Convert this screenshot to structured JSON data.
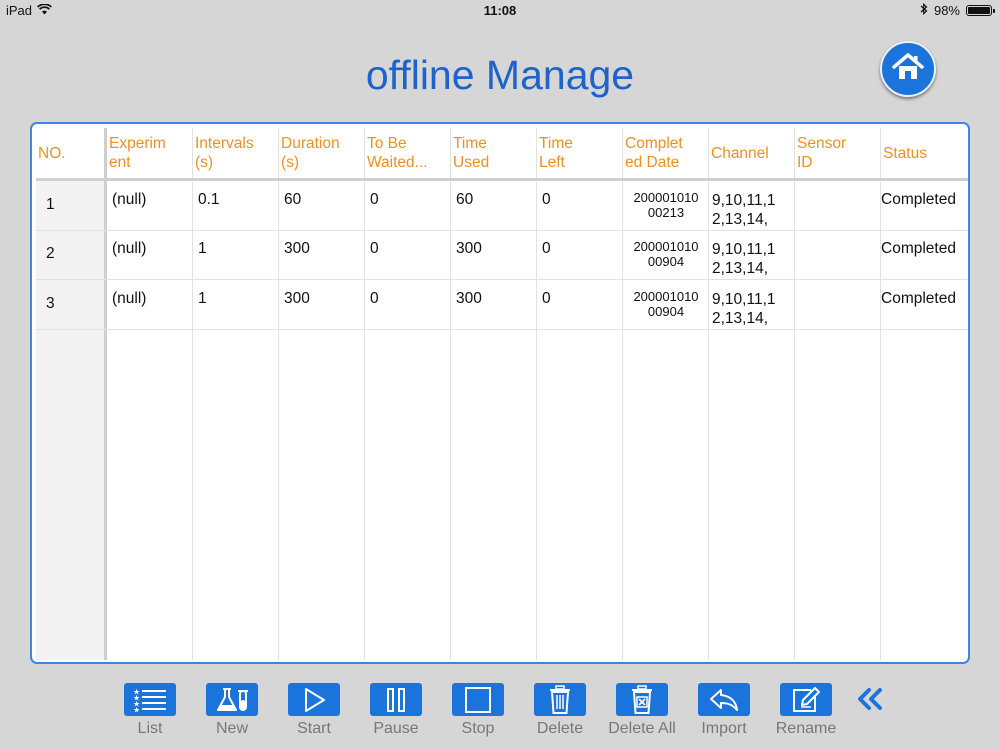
{
  "status_bar": {
    "device": "iPad",
    "time": "11:08",
    "battery": "98%",
    "battery_level": 0.98
  },
  "title": "offline Manage",
  "table": {
    "headers": [
      {
        "text": "NO.",
        "lines": [
          "NO."
        ]
      },
      {
        "text": "Experiment",
        "lines": [
          "Experim",
          "ent"
        ]
      },
      {
        "text": "Intervals (s)",
        "lines": [
          "Intervals",
          "(s)"
        ]
      },
      {
        "text": "Duration (s)",
        "lines": [
          "Duration",
          "(s)"
        ]
      },
      {
        "text": "To Be Waited...",
        "lines": [
          "To Be",
          "Waited..."
        ]
      },
      {
        "text": "Time Used",
        "lines": [
          "Time",
          "Used"
        ]
      },
      {
        "text": "Time Left",
        "lines": [
          "Time",
          "Left"
        ]
      },
      {
        "text": "Completed Date",
        "lines": [
          "Complet",
          "ed Date"
        ]
      },
      {
        "text": "Channel",
        "lines": [
          "Channel"
        ]
      },
      {
        "text": "Sensor ID",
        "lines": [
          "Sensor",
          "ID"
        ]
      },
      {
        "text": "Status",
        "lines": [
          "Status"
        ]
      }
    ],
    "rows": [
      {
        "no": "1",
        "experiment": "(null)",
        "intervals": "0.1",
        "duration": "60",
        "to_be_waited": "0",
        "time_used": "60",
        "time_left": "0",
        "completed_date": [
          "200001010",
          "00213"
        ],
        "channel": [
          "9,10,11,1",
          "2,13,14,"
        ],
        "sensor_id": "",
        "status": "Completed"
      },
      {
        "no": "2",
        "experiment": "(null)",
        "intervals": "1",
        "duration": "300",
        "to_be_waited": "0",
        "time_used": "300",
        "time_left": "0",
        "completed_date": [
          "200001010",
          "00904"
        ],
        "channel": [
          "9,10,11,1",
          "2,13,14,"
        ],
        "sensor_id": "",
        "status": "Completed"
      },
      {
        "no": "3",
        "experiment": "(null)",
        "intervals": "1",
        "duration": "300",
        "to_be_waited": "0",
        "time_used": "300",
        "time_left": "0",
        "completed_date": [
          "200001010",
          "00904"
        ],
        "channel": [
          "9,10,11,1",
          "2,13,14,"
        ],
        "sensor_id": "",
        "status": "Completed"
      }
    ]
  },
  "toolbar": {
    "buttons": [
      {
        "label": "List",
        "icon": "list-icon"
      },
      {
        "label": "New",
        "icon": "flask-icon"
      },
      {
        "label": "Start",
        "icon": "play-icon"
      },
      {
        "label": "Pause",
        "icon": "pause-icon"
      },
      {
        "label": "Stop",
        "icon": "stop-icon"
      },
      {
        "label": "Delete",
        "icon": "trash-icon"
      },
      {
        "label": "Delete All",
        "icon": "trash-x-icon"
      },
      {
        "label": "Import",
        "icon": "reply-icon"
      },
      {
        "label": "Rename",
        "icon": "edit-icon"
      }
    ],
    "collapse_icon": "double-chevron-left-icon"
  },
  "colors": {
    "accent": "#1b74dc",
    "header_text": "#f0901e",
    "title": "#1d63c9",
    "background": "#d6d6d6"
  }
}
